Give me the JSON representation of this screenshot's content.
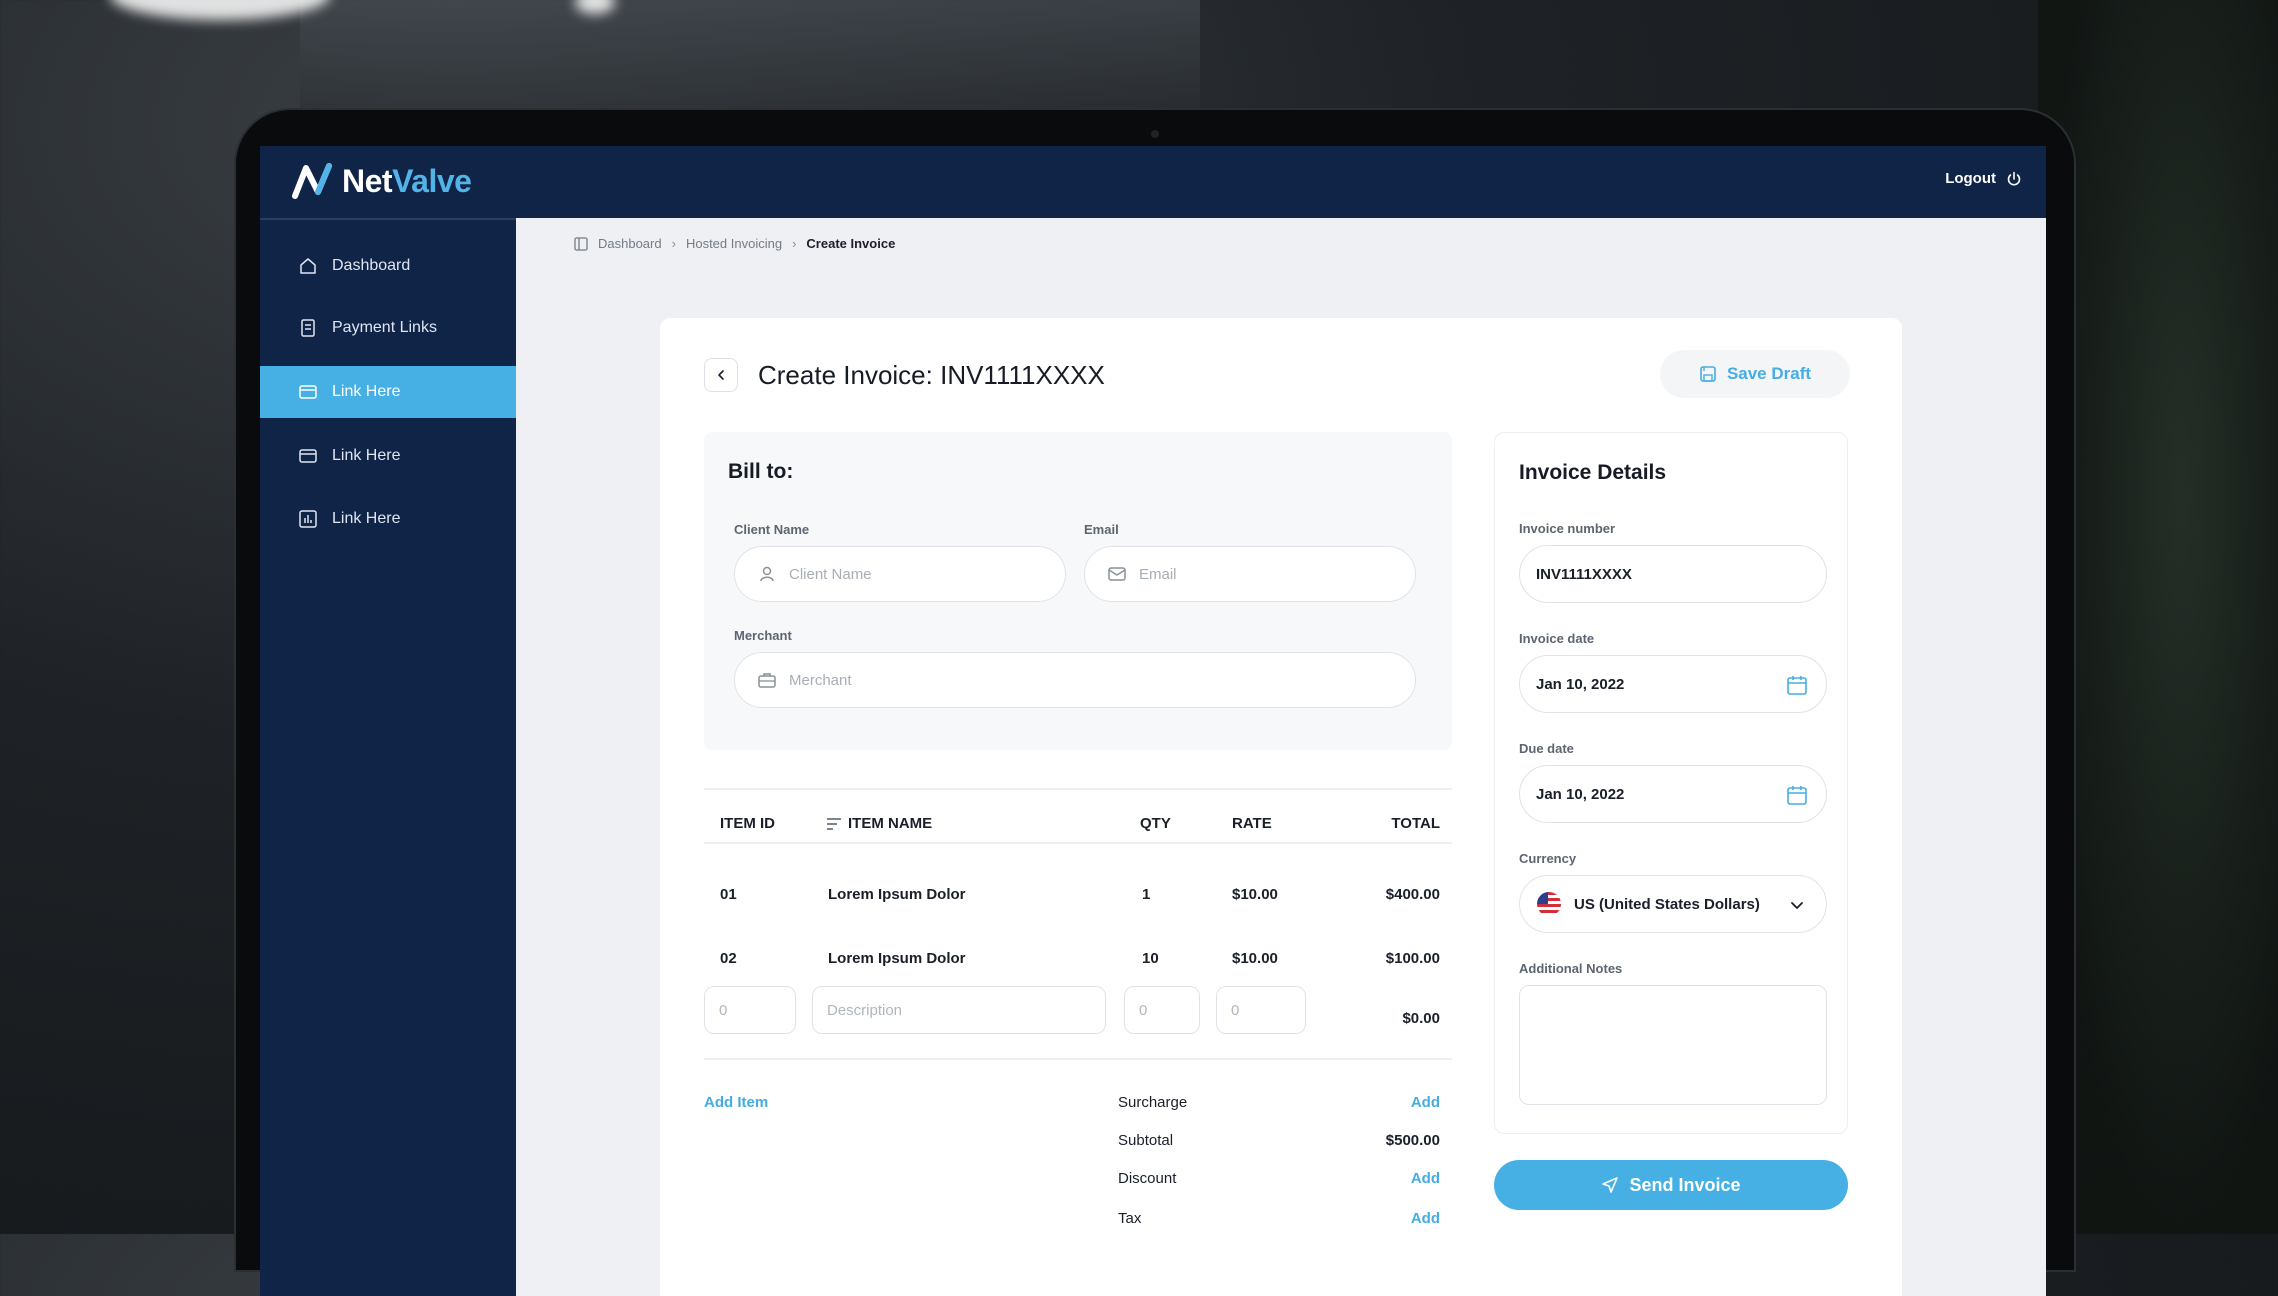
{
  "brand": {
    "name_part1": "Net",
    "name_part2": "Valve",
    "accent": "#52b3e8",
    "navy": "#102447"
  },
  "header": {
    "logout_label": "Logout"
  },
  "sidebar": {
    "items": [
      {
        "label": "Dashboard",
        "icon": "home-icon",
        "active": false
      },
      {
        "label": "Payment Links",
        "icon": "receipt-icon",
        "active": false
      },
      {
        "label": "Link Here",
        "icon": "card-icon",
        "active": true
      },
      {
        "label": "Link Here",
        "icon": "card-icon",
        "active": false
      },
      {
        "label": "Link Here",
        "icon": "chart-icon",
        "active": false
      }
    ]
  },
  "breadcrumb": {
    "items": [
      "Dashboard",
      "Hosted Invoicing"
    ],
    "current": "Create Invoice"
  },
  "page": {
    "title": "Create Invoice: INV1111XXXX",
    "save_draft_label": "Save Draft"
  },
  "bill_to": {
    "title": "Bill to:",
    "client_name": {
      "label": "Client Name",
      "placeholder": "Client Name"
    },
    "email": {
      "label": "Email",
      "placeholder": "Email"
    },
    "merchant": {
      "label": "Merchant",
      "placeholder": "Merchant"
    }
  },
  "items_table": {
    "headers": {
      "item_id": "ITEM ID",
      "item_name": "ITEM NAME",
      "qty": "QTY",
      "rate": "RATE",
      "total": "TOTAL"
    },
    "rows": [
      {
        "id": "01",
        "name": "Lorem Ipsum Dolor",
        "qty": "1",
        "rate": "$10.00",
        "total": "$400.00"
      },
      {
        "id": "02",
        "name": "Lorem Ipsum Dolor",
        "qty": "10",
        "rate": "$10.00",
        "total": "$100.00"
      }
    ],
    "new_row": {
      "id_placeholder": "0",
      "desc_placeholder": "Description",
      "qty_placeholder": "0",
      "rate_placeholder": "0",
      "total": "$0.00"
    },
    "add_item_label": "Add Item"
  },
  "summary": {
    "surcharge_label": "Surcharge",
    "surcharge_action": "Add",
    "subtotal_label": "Subtotal",
    "subtotal_value": "$500.00",
    "discount_label": "Discount",
    "discount_action": "Add",
    "tax_label": "Tax",
    "tax_action": "Add"
  },
  "invoice_details": {
    "title": "Invoice Details",
    "invoice_number_label": "Invoice number",
    "invoice_number": "INV1111XXXX",
    "invoice_date_label": "Invoice date",
    "invoice_date": "Jan 10, 2022",
    "due_date_label": "Due date",
    "due_date": "Jan 10, 2022",
    "currency_label": "Currency",
    "currency": "US (United States Dollars)",
    "notes_label": "Additional Notes"
  },
  "send_label": "Send Invoice"
}
